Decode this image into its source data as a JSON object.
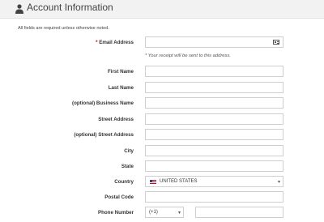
{
  "header": {
    "title": "Account Information",
    "icon": "user-icon"
  },
  "intro_text": "All fields are required unless otherwise noted.",
  "email": {
    "required_marker": "*",
    "label": "Email Address",
    "value": "",
    "icon": "contact-card-icon",
    "hint": "* Your receipt will be sent to this address."
  },
  "fields": {
    "first_name": {
      "label": "First Name",
      "value": ""
    },
    "last_name": {
      "label": "Last Name",
      "value": ""
    },
    "business_name": {
      "label": "(optional) Business Name",
      "value": ""
    },
    "street_address": {
      "label": "Street Address",
      "value": ""
    },
    "street_address_2": {
      "label": "(optional) Street Address",
      "value": ""
    },
    "city": {
      "label": "City",
      "value": ""
    },
    "state": {
      "label": "State",
      "value": ""
    },
    "country": {
      "label": "Country",
      "selected": "UNITED STATES",
      "icon": "us-flag-icon"
    },
    "postal_code": {
      "label": "Postal Code",
      "value": ""
    },
    "phone": {
      "label": "Phone Number",
      "country_code": "(+1)",
      "value": ""
    }
  },
  "colors": {
    "header_bg": "#f2f2f2",
    "required": "#c00000",
    "field_border": "#cfcfcf"
  }
}
